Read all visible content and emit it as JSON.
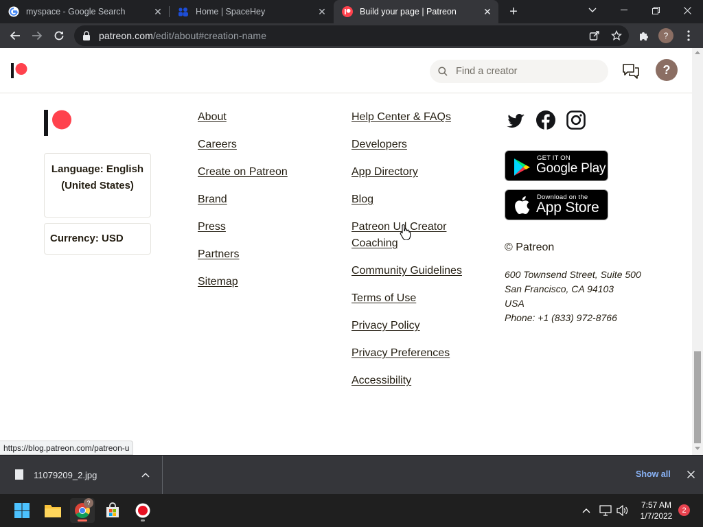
{
  "browser": {
    "tabs": [
      {
        "title": "myspace - Google Search",
        "favicon": "google-icon",
        "active": false
      },
      {
        "title": "Home | SpaceHey",
        "favicon": "spacehey-icon",
        "active": false
      },
      {
        "title": "Build your page | Patreon",
        "favicon": "patreon-icon",
        "active": true
      }
    ],
    "url_host": "patreon.com",
    "url_path": "/edit/about#creation-name",
    "profile_letter": "?"
  },
  "header": {
    "search_placeholder": "Find a creator",
    "help_label": "?"
  },
  "footer": {
    "language_label": "Language: English (United States)",
    "currency_label": "Currency: USD",
    "col1": [
      "About",
      "Careers",
      "Create on Patreon",
      "Brand",
      "Press",
      "Partners",
      "Sitemap"
    ],
    "col2": [
      "Help Center & FAQs",
      "Developers",
      "App Directory",
      "Blog",
      "Patreon U | Creator Coaching",
      "Community Guidelines",
      "Terms of Use",
      "Privacy Policy",
      "Privacy Preferences",
      "Accessibility"
    ],
    "social": [
      "twitter-icon",
      "facebook-icon",
      "instagram-icon"
    ],
    "google_play": {
      "small": "GET IT ON",
      "big": "Google Play"
    },
    "app_store": {
      "small": "Download on the",
      "big": "App Store"
    },
    "copyright": "© Patreon",
    "address": [
      "600 Townsend Street, Suite 500",
      "San Francisco, CA 94103",
      "USA",
      "Phone: +1 (833) 972-8766"
    ]
  },
  "status_url": "https://blog.patreon.com/patreon-u",
  "downloads": {
    "file_name": "11079209_2.jpg",
    "show_all": "Show all"
  },
  "taskbar": {
    "time": "7:57 AM",
    "date": "1/7/2022",
    "notification_count": "2",
    "chrome_badge": "?"
  },
  "colors": {
    "patreon_coral": "#ff424d",
    "patreon_navy": "#141518",
    "text": "#241e12",
    "chrome_dark": "#202124",
    "chrome_toolbar": "#35363a",
    "link_blue": "#8ab4f8"
  }
}
